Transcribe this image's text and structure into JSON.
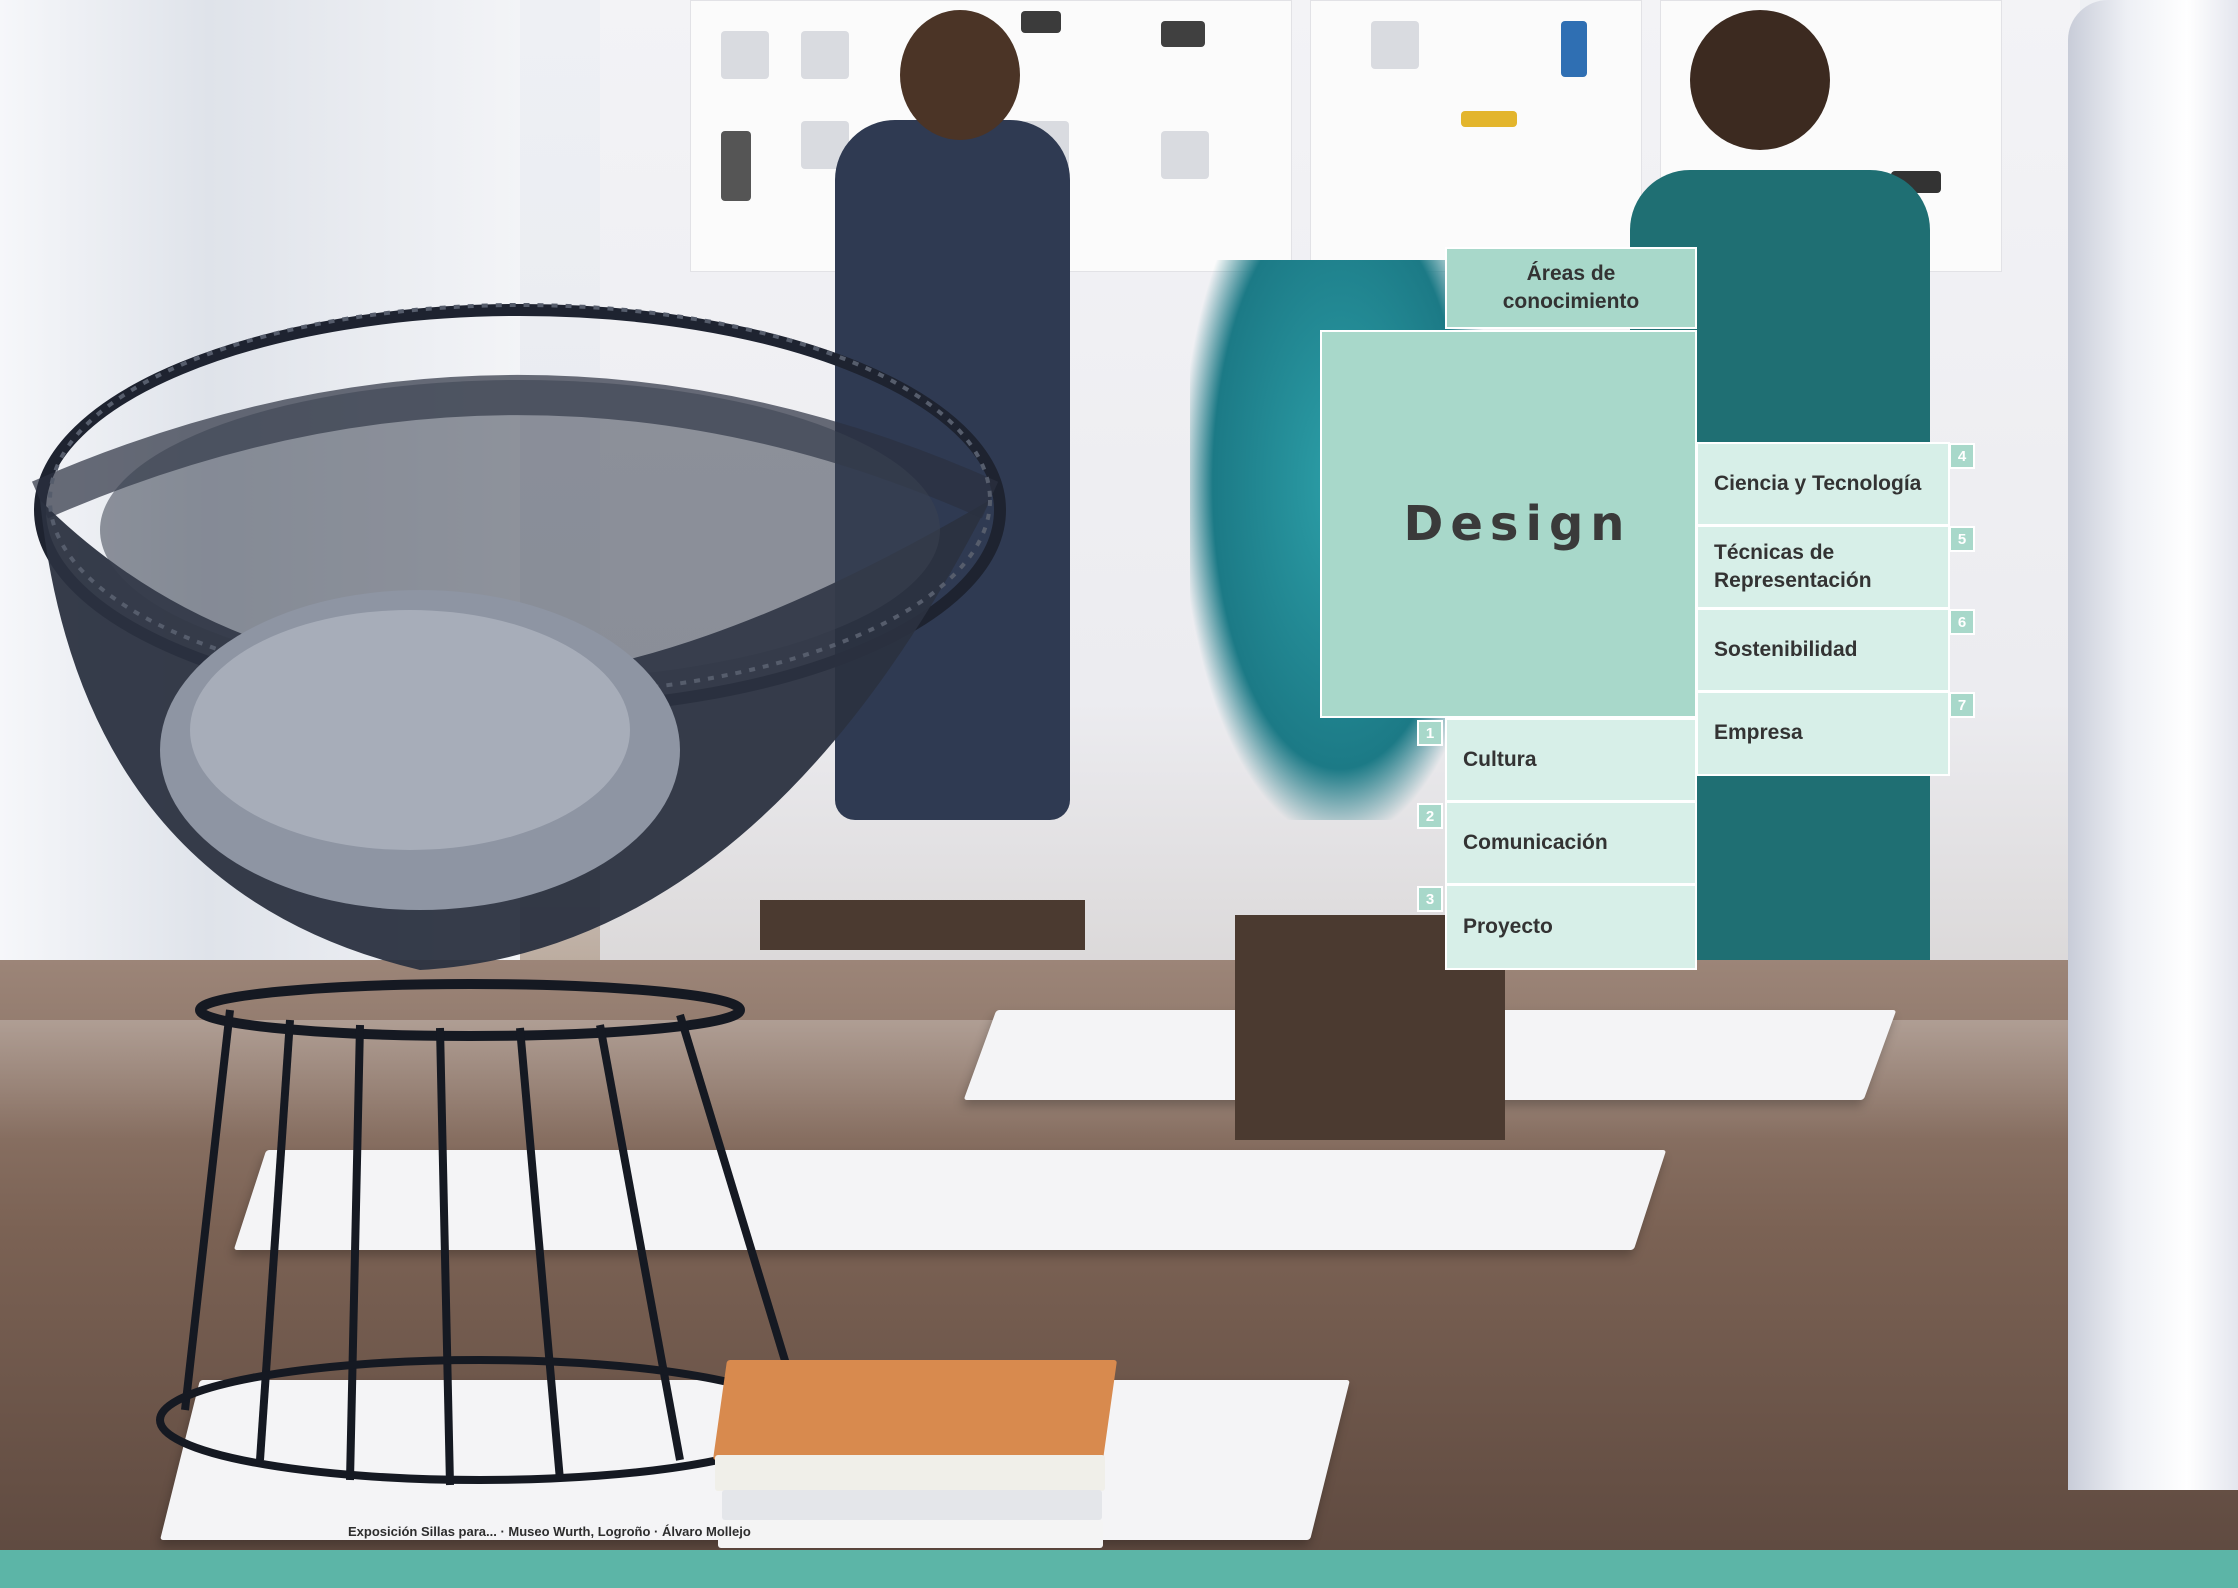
{
  "areas_tab": {
    "label": "Áreas de conocimiento"
  },
  "design": {
    "title": "Design"
  },
  "left_menu": [
    {
      "number": "1",
      "label": "Cultura"
    },
    {
      "number": "2",
      "label": "Comunicación"
    },
    {
      "number": "3",
      "label": "Proyecto"
    }
  ],
  "right_menu": [
    {
      "number": "4",
      "label": "Ciencia y Tecnología"
    },
    {
      "number": "5",
      "label": "Técnicas de Representación"
    },
    {
      "number": "6",
      "label": "Sostenibilidad"
    },
    {
      "number": "7",
      "label": "Empresa"
    }
  ],
  "photo_credit": "Exposición Sillas para... · Museo Wurth, Logroño · Álvaro Mollejo",
  "colors": {
    "accent_dark": "#5cb5a7",
    "accent_mid": "#a8d8ca",
    "accent_light": "#d7efe8",
    "text": "#333333"
  }
}
